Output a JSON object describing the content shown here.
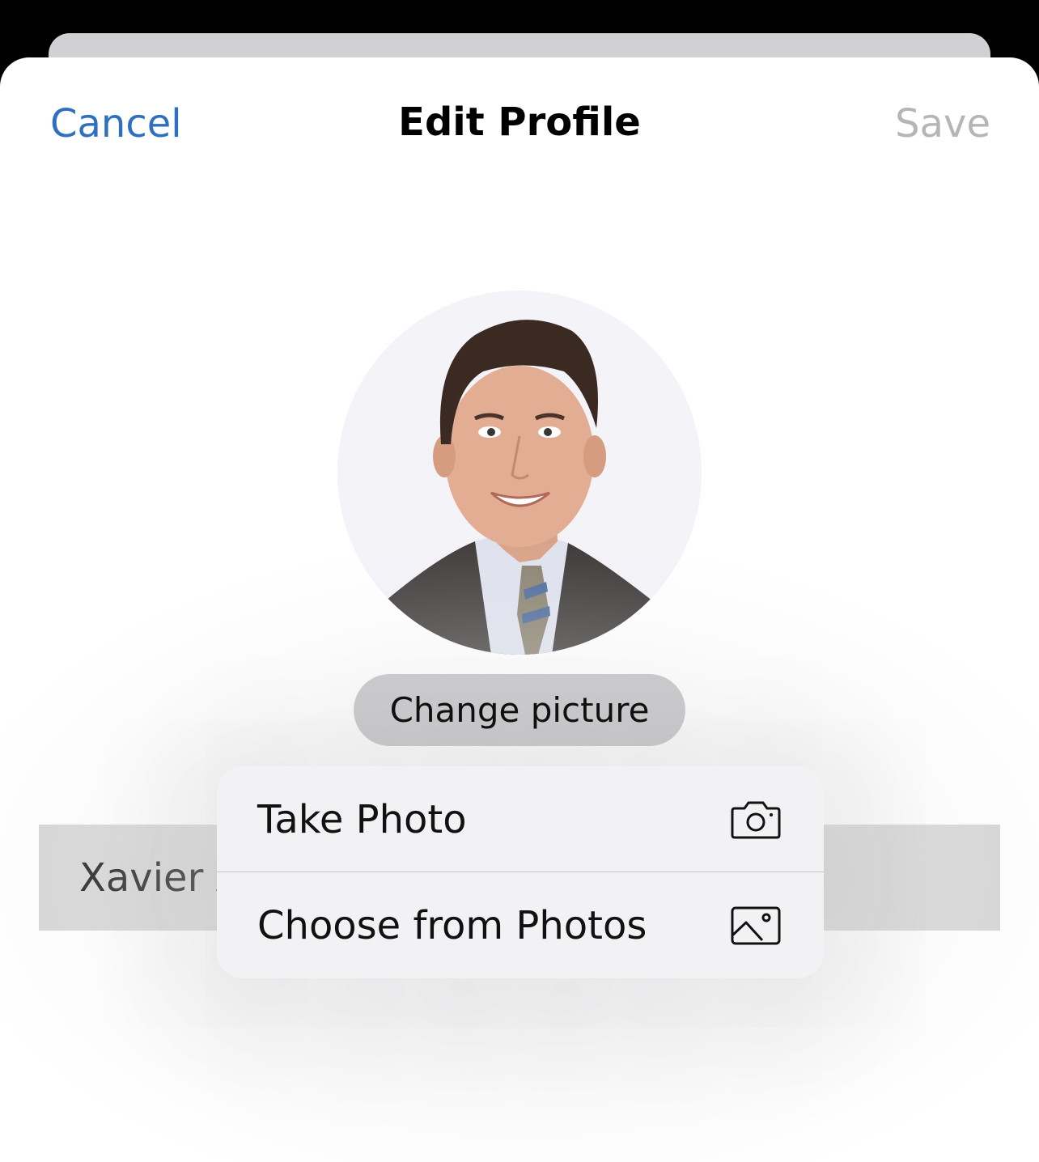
{
  "nav": {
    "cancel_label": "Cancel",
    "title": "Edit Profile",
    "save_label": "Save"
  },
  "profile": {
    "change_picture_label": "Change picture",
    "name_partial": "Xavier A"
  },
  "menu": {
    "items": [
      {
        "label": "Take Photo",
        "icon": "camera-icon"
      },
      {
        "label": "Choose from Photos",
        "icon": "photo-icon"
      }
    ]
  },
  "colors": {
    "accent": "#2f6fbf",
    "disabled": "#b5b5b5",
    "menu_bg": "#f2f2f4",
    "pill_bg": "#cbcbcd"
  }
}
